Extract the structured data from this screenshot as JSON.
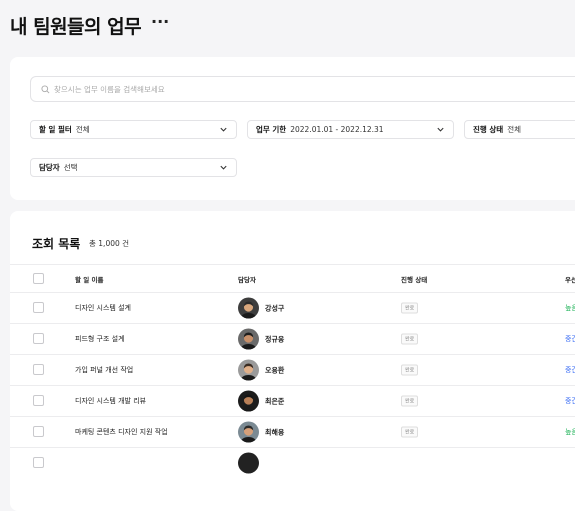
{
  "page": {
    "title": "내 팀원들의 업무",
    "more_icon": "ellipsis-icon",
    "more_glyph": "···"
  },
  "filters": {
    "search_placeholder": "찾으시는 업무 이름을 검색해보세요",
    "todo_filter": {
      "label": "할 일 필터",
      "value": "전체"
    },
    "period": {
      "label": "업무 기한",
      "value": "2022.01.01 - 2022.12.31"
    },
    "status": {
      "label": "진행 상태",
      "value": "전체"
    },
    "owner": {
      "label": "담당자",
      "value": "선택"
    }
  },
  "list": {
    "title": "조회 목록",
    "count": "총 1,000 건",
    "columns": {
      "name": "할 일 이름",
      "owner": "담당자",
      "status": "진행 상태",
      "priority": "우선"
    },
    "rows": [
      {
        "name": "디자인 시스템 설계",
        "owner": "강성구",
        "status": "완료",
        "priority": "높음",
        "priority_color": "#21b35a"
      },
      {
        "name": "피드형 구조 설계",
        "owner": "정규웅",
        "status": "완료",
        "priority": "중간",
        "priority_color": "#3b6ef5"
      },
      {
        "name": "가입 퍼널 개선 작업",
        "owner": "오용환",
        "status": "완료",
        "priority": "중간",
        "priority_color": "#3b6ef5"
      },
      {
        "name": "디자인 시스템 개발 리뷰",
        "owner": "최은준",
        "status": "완료",
        "priority": "중간",
        "priority_color": "#3b6ef5"
      },
      {
        "name": "마케팅 콘텐츠 디자인 지원 작업",
        "owner": "최해용",
        "status": "완료",
        "priority": "높음",
        "priority_color": "#21b35a"
      },
      {
        "name": "",
        "owner": "",
        "status": "",
        "priority": "",
        "priority_color": "#21b35a"
      }
    ]
  }
}
